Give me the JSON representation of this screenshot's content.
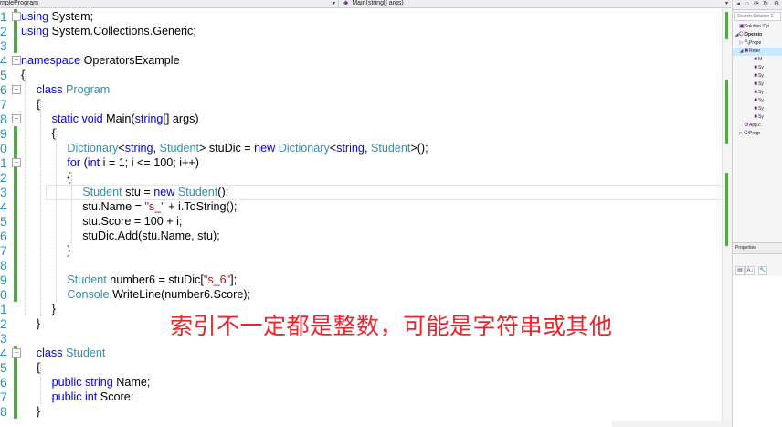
{
  "navbar": {
    "left_dropdown": "mpleProgram",
    "right_dropdown": "Main(string[] args)"
  },
  "editor": {
    "lines": [
      {
        "n": "1",
        "bar": "saved",
        "fold": "minus",
        "indent": 0,
        "tokens": [
          [
            "kw",
            "using"
          ],
          [
            "p",
            " System;"
          ]
        ]
      },
      {
        "n": "2",
        "bar": "saved",
        "fold": "",
        "indent": 0,
        "tokens": [
          [
            "kw",
            "using"
          ],
          [
            "p",
            " System.Collections.Generic;"
          ]
        ]
      },
      {
        "n": "3",
        "bar": "saved",
        "fold": "",
        "indent": 0,
        "tokens": []
      },
      {
        "n": "4",
        "bar": "",
        "fold": "minus",
        "indent": 0,
        "tokens": [
          [
            "kw",
            "namespace"
          ],
          [
            "p",
            " OperatorsExample"
          ]
        ]
      },
      {
        "n": "5",
        "bar": "",
        "fold": "",
        "indent": 0,
        "tokens": [
          [
            "p",
            "{"
          ]
        ]
      },
      {
        "n": "6",
        "bar": "",
        "fold": "minus",
        "indent": 1,
        "tokens": [
          [
            "kw",
            "class"
          ],
          [
            "p",
            " "
          ],
          [
            "ty",
            "Program"
          ]
        ]
      },
      {
        "n": "7",
        "bar": "",
        "fold": "",
        "indent": 1,
        "tokens": [
          [
            "p",
            "{"
          ]
        ]
      },
      {
        "n": "8",
        "bar": "",
        "fold": "minus",
        "indent": 2,
        "tokens": [
          [
            "kw",
            "static"
          ],
          [
            "p",
            " "
          ],
          [
            "kw",
            "void"
          ],
          [
            "p",
            " Main("
          ],
          [
            "kw",
            "string"
          ],
          [
            "p",
            "[] args)"
          ]
        ]
      },
      {
        "n": "9",
        "bar": "saved",
        "fold": "",
        "indent": 2,
        "tokens": [
          [
            "p",
            "{"
          ]
        ]
      },
      {
        "n": "0",
        "bar": "saved",
        "fold": "",
        "indent": 3,
        "tokens": [
          [
            "ty",
            "Dictionary"
          ],
          [
            "p",
            "<"
          ],
          [
            "kw",
            "string"
          ],
          [
            "p",
            ", "
          ],
          [
            "ty",
            "Student"
          ],
          [
            "p",
            "> stuDic = "
          ],
          [
            "kw",
            "new"
          ],
          [
            "p",
            " "
          ],
          [
            "ty",
            "Dictionary"
          ],
          [
            "p",
            "<"
          ],
          [
            "kw",
            "string"
          ],
          [
            "p",
            ", "
          ],
          [
            "ty",
            "Student"
          ],
          [
            "p",
            ">();"
          ]
        ]
      },
      {
        "n": "1",
        "bar": "saved",
        "fold": "minus",
        "indent": 3,
        "tokens": [
          [
            "kw",
            "for"
          ],
          [
            "p",
            " ("
          ],
          [
            "kw",
            "int"
          ],
          [
            "p",
            " i = 1; i <= 100; i++)"
          ]
        ]
      },
      {
        "n": "2",
        "bar": "saved",
        "fold": "",
        "indent": 3,
        "tokens": [
          [
            "p",
            "{"
          ]
        ]
      },
      {
        "n": "3",
        "bar": "saved",
        "fold": "",
        "indent": 4,
        "current": true,
        "tokens": [
          [
            "ty",
            "Student"
          ],
          [
            "p",
            " stu = "
          ],
          [
            "kw",
            "new"
          ],
          [
            "p",
            " "
          ],
          [
            "ty",
            "Student"
          ],
          [
            "p",
            "();"
          ]
        ]
      },
      {
        "n": "4",
        "bar": "saved",
        "fold": "",
        "indent": 4,
        "tokens": [
          [
            "p",
            "stu.Name = "
          ],
          [
            "str",
            "\"s_\""
          ],
          [
            "p",
            " + i.ToString();"
          ]
        ]
      },
      {
        "n": "5",
        "bar": "saved",
        "fold": "",
        "indent": 4,
        "tokens": [
          [
            "p",
            "stu.Score = 100 + i;"
          ]
        ]
      },
      {
        "n": "6",
        "bar": "saved",
        "fold": "",
        "indent": 4,
        "tokens": [
          [
            "p",
            "stuDic.Add(stu.Name, stu);"
          ]
        ]
      },
      {
        "n": "7",
        "bar": "saved",
        "fold": "",
        "indent": 3,
        "tokens": [
          [
            "p",
            "}"
          ]
        ]
      },
      {
        "n": "8",
        "bar": "saved",
        "fold": "",
        "indent": 3,
        "tokens": []
      },
      {
        "n": "9",
        "bar": "saved",
        "fold": "",
        "indent": 3,
        "tokens": [
          [
            "ty",
            "Student"
          ],
          [
            "p",
            " number6 = stuDic["
          ],
          [
            "str",
            "\"s_6\""
          ],
          [
            "p",
            "];"
          ]
        ]
      },
      {
        "n": "0",
        "bar": "saved",
        "fold": "",
        "indent": 3,
        "tokens": [
          [
            "ty",
            "Console"
          ],
          [
            "p",
            ".WriteLine(number6.Score);"
          ]
        ]
      },
      {
        "n": "1",
        "bar": "",
        "fold": "",
        "indent": 2,
        "tokens": [
          [
            "p",
            "}"
          ]
        ]
      },
      {
        "n": "2",
        "bar": "",
        "fold": "",
        "indent": 1,
        "tokens": [
          [
            "p",
            "}"
          ]
        ]
      },
      {
        "n": "3",
        "bar": "",
        "fold": "",
        "indent": 1,
        "tokens": []
      },
      {
        "n": "4",
        "bar": "saved",
        "fold": "minus",
        "indent": 1,
        "tokens": [
          [
            "kw",
            "class"
          ],
          [
            "p",
            " "
          ],
          [
            "ty",
            "Student"
          ]
        ]
      },
      {
        "n": "5",
        "bar": "saved",
        "fold": "",
        "indent": 1,
        "tokens": [
          [
            "p",
            "{"
          ]
        ]
      },
      {
        "n": "6",
        "bar": "saved",
        "fold": "",
        "indent": 2,
        "tokens": [
          [
            "kw",
            "public"
          ],
          [
            "p",
            " "
          ],
          [
            "kw",
            "string"
          ],
          [
            "p",
            " Name;"
          ]
        ]
      },
      {
        "n": "7",
        "bar": "saved",
        "fold": "",
        "indent": 2,
        "tokens": [
          [
            "kw",
            "public"
          ],
          [
            "p",
            " "
          ],
          [
            "kw",
            "int"
          ],
          [
            "p",
            " Score;"
          ]
        ]
      },
      {
        "n": "8",
        "bar": "saved",
        "fold": "",
        "indent": 1,
        "tokens": [
          [
            "p",
            "}"
          ]
        ]
      }
    ]
  },
  "overlay_note": "索引不一定都是整数，可能是字符串或其他",
  "solution_explorer": {
    "search_placeholder": "Search Solution E",
    "rows": [
      {
        "label": "Solution 'Op",
        "twisty": "",
        "icon": "▣",
        "level": 0,
        "bold": false,
        "selected": false
      },
      {
        "label": "Operato",
        "twisty": "◢",
        "icon": "C#",
        "level": 0,
        "bold": true,
        "selected": false
      },
      {
        "label": "Prope",
        "twisty": "▷",
        "icon": "🔧",
        "level": 1,
        "bold": false,
        "selected": false
      },
      {
        "label": "Refer",
        "twisty": "◢",
        "icon": "■",
        "level": 1,
        "bold": false,
        "selected": true
      },
      {
        "label": "M",
        "twisty": "",
        "icon": "■",
        "level": 3,
        "bold": false,
        "selected": false
      },
      {
        "label": "Sy",
        "twisty": "",
        "icon": "■",
        "level": 3,
        "bold": false,
        "selected": false
      },
      {
        "label": "Sy",
        "twisty": "",
        "icon": "■",
        "level": 3,
        "bold": false,
        "selected": false
      },
      {
        "label": "Sy",
        "twisty": "",
        "icon": "■",
        "level": 3,
        "bold": false,
        "selected": false
      },
      {
        "label": "Sy",
        "twisty": "",
        "icon": "■",
        "level": 3,
        "bold": false,
        "selected": false
      },
      {
        "label": "Sy",
        "twisty": "",
        "icon": "■",
        "level": 3,
        "bold": false,
        "selected": false
      },
      {
        "label": "Sy",
        "twisty": "",
        "icon": "■",
        "level": 3,
        "bold": false,
        "selected": false
      },
      {
        "label": "Sy",
        "twisty": "",
        "icon": "■",
        "level": 3,
        "bold": false,
        "selected": false
      },
      {
        "label": "App.c",
        "twisty": "",
        "icon": "⚙",
        "level": 1,
        "bold": false,
        "selected": false
      },
      {
        "label": "Progr",
        "twisty": "▷",
        "icon": "C#",
        "level": 1,
        "bold": false,
        "selected": false
      }
    ]
  },
  "properties": {
    "title": "Properties"
  },
  "colors": {
    "keyword": "#0000ff",
    "type": "#2b91af",
    "string": "#a31515",
    "saved_change": "#57a64a",
    "note": "#e8262d"
  }
}
